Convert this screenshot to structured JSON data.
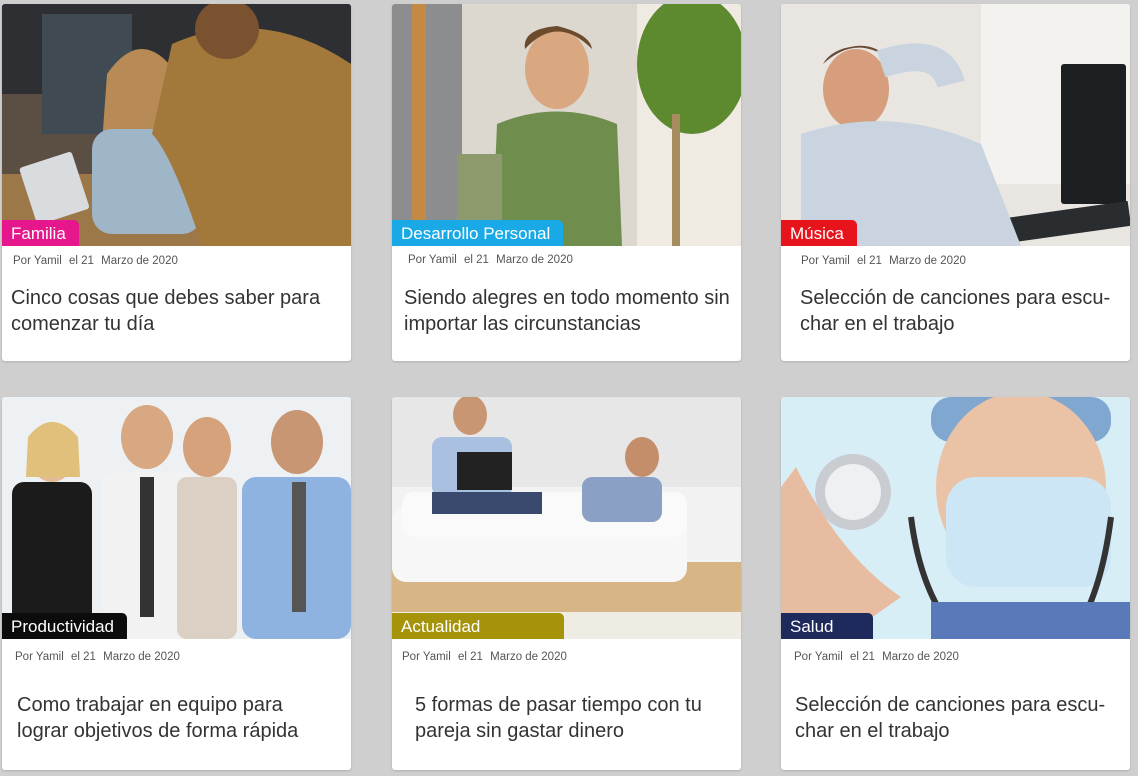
{
  "posts": [
    {
      "category": "Familia",
      "category_color": "#e6168c",
      "author": "Por Yamil",
      "day": "el 21",
      "month_year": "Marzo de 2020",
      "title": "Cinco cosas que debes saber para comenzar tu día",
      "image": "office-team-laptop-photo"
    },
    {
      "category": "Desarrollo Personal",
      "category_color": "#19a9e6",
      "author": "Por Yamil",
      "day": "el 21",
      "month_year": "Marzo de 2020",
      "title": "Siendo alegres en todo momento sin importar las circunstancias",
      "image": "man-on-phone-photo"
    },
    {
      "category": "Música",
      "category_color": "#e8141c",
      "author": "Por Yamil",
      "day": "el 21",
      "month_year": "Marzo de 2020",
      "title": "Selección de canciones para escu-char en el trabajo",
      "image": "relaxed-man-office-photo"
    },
    {
      "category": "Productividad",
      "category_color": "#0c0c0c",
      "author": "Por Yamil",
      "day": "el 21",
      "month_year": "Marzo de 2020",
      "title": "Como trabajar en equipo para lograr objetivos de forma rápida",
      "image": "team-thumbs-up-photo"
    },
    {
      "category": "Actualidad",
      "category_color": "#a59409",
      "author": "Por Yamil",
      "day": "el 21",
      "month_year": "Marzo de 2020",
      "title": "5 formas de pasar tiempo con tu pareja sin gastar dinero",
      "image": "couple-sofa-laptops-photo"
    },
    {
      "category": "Salud",
      "category_color": "#1e2a5c",
      "author": "Por Yamil",
      "day": "el 21",
      "month_year": "Marzo de 2020",
      "title": "Selección de canciones para escu-char en el trabajo",
      "image": "nurse-stethoscope-photo"
    }
  ]
}
